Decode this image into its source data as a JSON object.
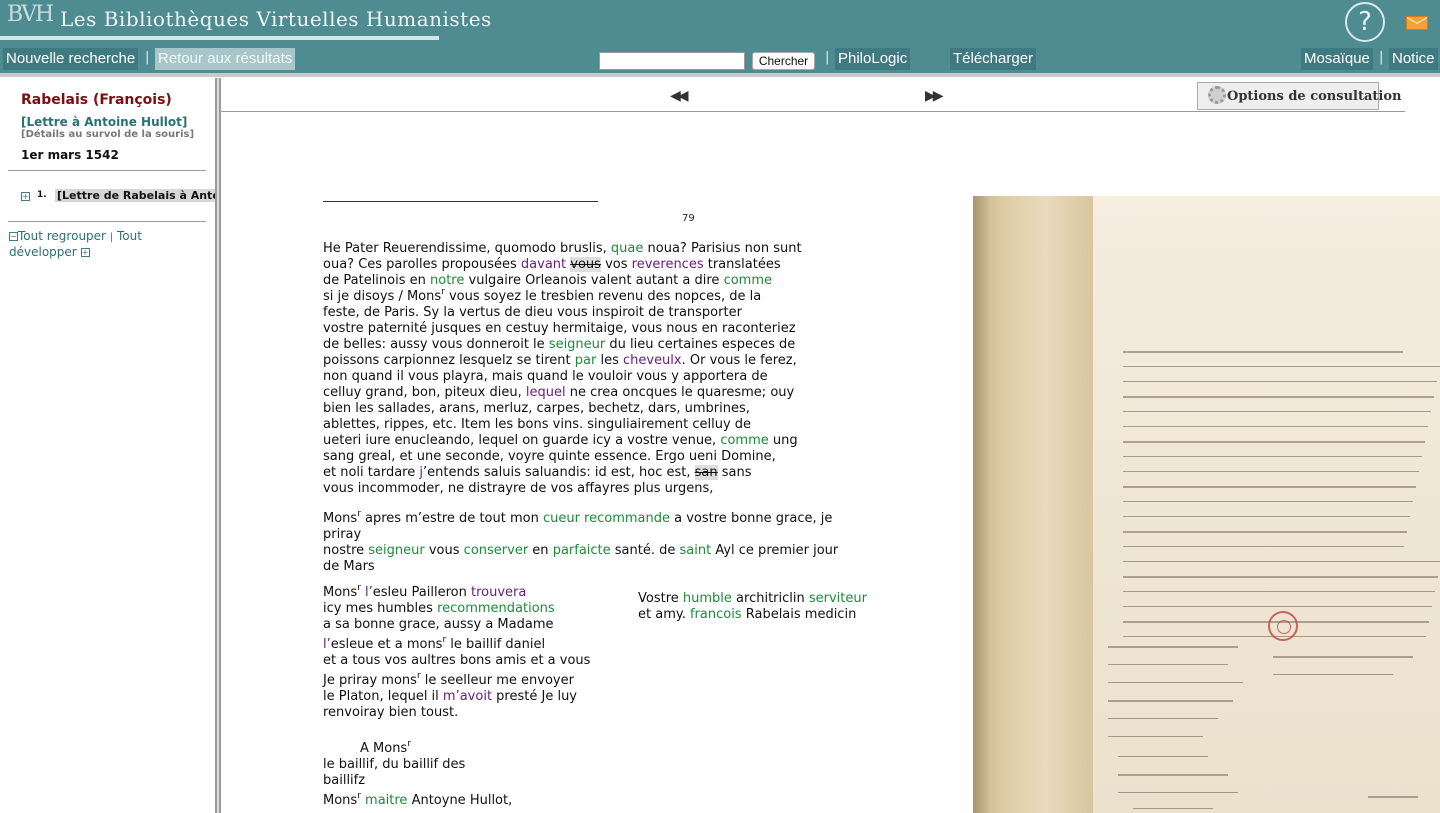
{
  "header": {
    "logo": "BVH",
    "site_title": "Les Bibliothèques Virtuelles Humanistes",
    "help_label": "?"
  },
  "nav": {
    "new_search": "Nouvelle recherche",
    "back_to_results": "Retour aux résultats",
    "search_placeholder": "",
    "search_button": "Chercher",
    "philologic": "PhiloLogic",
    "download": "Télécharger",
    "mosaic": "Mosaïque",
    "notice": "Notice"
  },
  "sidebar": {
    "author": "Rabelais (François)",
    "work_title": "[Lettre à Antoine Hullot]",
    "hover_note": "[Détails au survol de la souris]",
    "date": "1er mars 1542",
    "toc": [
      {
        "num": "1.",
        "label": "[Lettre de Rabelais à Antoine Hullot]"
      }
    ],
    "collapse_all": "Tout regrouper",
    "separator": "|",
    "expand_all_a": "Tout",
    "expand_all_b": "développer"
  },
  "viewer": {
    "options_label": "Options de consultation",
    "page_number": "79"
  },
  "colors": {
    "header_bg": "#4e8c92",
    "author": "#7a0f12",
    "link_teal": "#2a7078",
    "variant_green": "#1f8a3a",
    "variant_purple": "#6a1f80"
  },
  "text": {
    "l1": [
      [
        "He Pater Reuerendissime, quomodo bruslis, ",
        ""
      ],
      [
        "quae",
        "g"
      ],
      [
        " noua? Parisius non sunt",
        ""
      ]
    ],
    "l2": [
      [
        "oua? Ces parolles propousées ",
        ""
      ],
      [
        "davant",
        "p"
      ],
      [
        " ",
        ""
      ],
      [
        "vous",
        "s"
      ],
      [
        " vos ",
        ""
      ],
      [
        "reverences",
        "p"
      ],
      [
        " translatées",
        ""
      ]
    ],
    "l3": [
      [
        "de Patelinois en ",
        ""
      ],
      [
        "notre",
        "g"
      ],
      [
        " vulgaire Orleanois valent autant a dire ",
        ""
      ],
      [
        "comme",
        "g"
      ]
    ],
    "l4": [
      [
        "si je disoys / Mons",
        ""
      ],
      [
        "r",
        "sup"
      ],
      [
        " vous soyez le tresbien revenu des nopces, de la",
        ""
      ]
    ],
    "l5": [
      [
        "feste, de Paris. Sy la vertus de dieu vous inspiroit de transporter",
        ""
      ]
    ],
    "l6": [
      [
        "vostre paternité jusques en cestuy hermitaige, vous nous en raconteriez",
        ""
      ]
    ],
    "l7": [
      [
        "de belles: aussy vous donneroit le ",
        ""
      ],
      [
        "seigneur",
        "g"
      ],
      [
        " du lieu certaines especes de",
        ""
      ]
    ],
    "l8": [
      [
        "poissons carpionnez lesquelz se tirent ",
        ""
      ],
      [
        "par",
        "g"
      ],
      [
        " les ",
        ""
      ],
      [
        "cheveulx",
        "p"
      ],
      [
        ". Or vous le ferez,",
        ""
      ]
    ],
    "l9": [
      [
        "non quand il vous playra, mais quand le vouloir vous y apportera de",
        ""
      ]
    ],
    "l10": [
      [
        "celluy grand, bon, piteux dieu, ",
        ""
      ],
      [
        "lequel",
        "p"
      ],
      [
        " ne crea oncques le quaresme; ouy",
        ""
      ]
    ],
    "l11": [
      [
        "bien les sallades, arans, merluz, carpes, bechetz, dars, umbrines,",
        ""
      ]
    ],
    "l12": [
      [
        "ablettes, rippes, etc. Item les bons vins. singuliairement celluy de",
        ""
      ]
    ],
    "l13": [
      [
        "ueteri iure enucleando, lequel on guarde icy a vostre venue, ",
        ""
      ],
      [
        "comme",
        "g"
      ],
      [
        " ung",
        ""
      ]
    ],
    "l14": [
      [
        "sang greal, et une seconde, voyre quinte essence. Ergo ueni Domine,",
        ""
      ]
    ],
    "l15": [
      [
        "et noli tardare ",
        ""
      ],
      [
        "j",
        "p"
      ],
      [
        "’entends saluis saluandis: id est, hoc est, ",
        ""
      ],
      [
        "san",
        "s"
      ],
      [
        " sans",
        ""
      ]
    ],
    "l16": [
      [
        "vous incommoder, ne distrayre de vos affayres plus urgens,",
        ""
      ]
    ],
    "l17": [
      [
        "Mons",
        ""
      ],
      [
        "r",
        "sup"
      ],
      [
        " apres m’estre de tout mon ",
        ""
      ],
      [
        "cueur recommande",
        "g"
      ],
      [
        " a vostre bonne grace, je",
        ""
      ]
    ],
    "l18": [
      [
        "priray",
        ""
      ]
    ],
    "l19": [
      [
        "nostre ",
        ""
      ],
      [
        "seigneur",
        "g"
      ],
      [
        " vous ",
        ""
      ],
      [
        "conserver",
        "g"
      ],
      [
        " en ",
        ""
      ],
      [
        "parfaicte",
        "g"
      ],
      [
        " santé. de ",
        ""
      ],
      [
        "saint",
        "g"
      ],
      [
        " Ayl ce premier jour",
        ""
      ]
    ],
    "l20": [
      [
        "de Mars",
        ""
      ]
    ],
    "l21": [
      [
        "Mons",
        ""
      ],
      [
        "r",
        "sup"
      ],
      [
        " ",
        ""
      ],
      [
        "l’",
        "p"
      ],
      [
        "esleu Pailleron ",
        ""
      ],
      [
        "trouvera",
        "p"
      ]
    ],
    "l22": [
      [
        "icy mes humbles ",
        ""
      ],
      [
        "recommendations",
        "g"
      ]
    ],
    "l23": [
      [
        "a sa bonne grace, aussy a Madame",
        ""
      ]
    ],
    "l24": [
      [
        "l’",
        "p"
      ],
      [
        "esleue et a mons",
        ""
      ],
      [
        "r",
        "sup"
      ],
      [
        " le baillif daniel",
        ""
      ]
    ],
    "l25": [
      [
        "et a tous vos aultres bons amis et a vous",
        ""
      ]
    ],
    "l26": [
      [
        "Je priray mons",
        ""
      ],
      [
        "r",
        "sup"
      ],
      [
        " le seelleur me envoyer",
        ""
      ]
    ],
    "l27": [
      [
        "le Platon, lequel il ",
        ""
      ],
      [
        "m’avoit",
        "p"
      ],
      [
        " presté Je luy",
        ""
      ]
    ],
    "l28": [
      [
        "renvoiray bien toust.",
        ""
      ]
    ],
    "l29": [
      [
        "A Mons",
        ""
      ],
      [
        "r",
        "sup"
      ]
    ],
    "l30": [
      [
        "le baillif, du baillif des",
        ""
      ]
    ],
    "l31": [
      [
        "baillifz",
        ""
      ]
    ],
    "l32": [
      [
        "Mons",
        ""
      ],
      [
        "r",
        "sup"
      ],
      [
        " ",
        ""
      ],
      [
        "maitre",
        "g"
      ],
      [
        " Antoyne Hullot,",
        ""
      ]
    ],
    "l33": [
      [
        "Vostre ",
        ""
      ],
      [
        "humble",
        "g"
      ],
      [
        " architriclin ",
        ""
      ],
      [
        "serviteur",
        "g"
      ]
    ],
    "l34": [
      [
        "et amy. ",
        ""
      ],
      [
        "francois",
        "g"
      ],
      [
        " Rabelais medicin",
        ""
      ]
    ]
  }
}
